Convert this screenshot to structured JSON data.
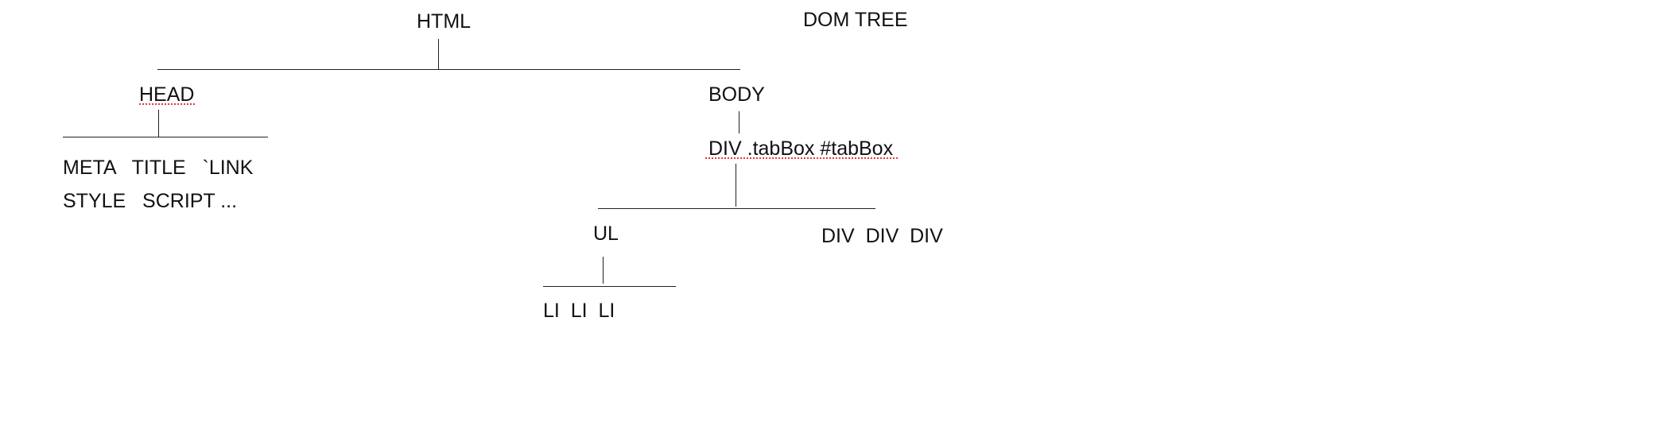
{
  "diagram": {
    "title": "DOM TREE",
    "root": "HTML",
    "head": {
      "label": "HEAD",
      "children_line1": "META   TITLE   `LINK",
      "children_line2": "STYLE   SCRIPT ..."
    },
    "body": {
      "label": "BODY",
      "div": "DIV .tabBox #tabBox",
      "ul": "UL",
      "li_items": "LI  LI  LI",
      "div_items": "DIV  DIV  DIV"
    },
    "colors": {
      "line": "#222222",
      "text": "#111111",
      "spellcheck_underline": "#e23a3a"
    }
  }
}
